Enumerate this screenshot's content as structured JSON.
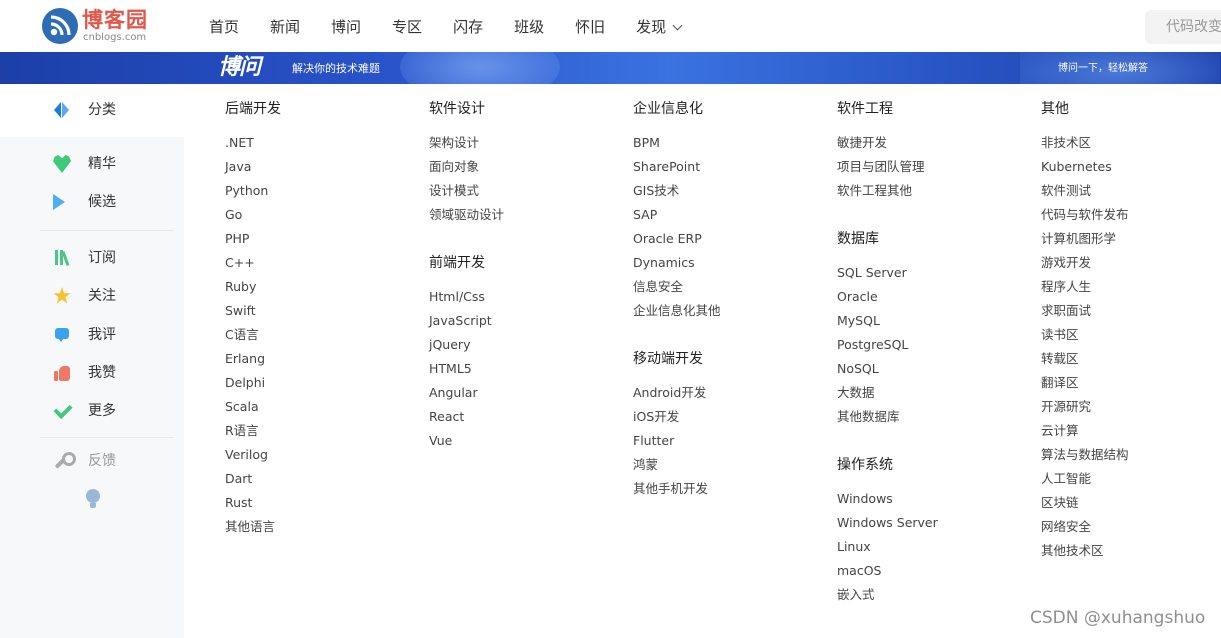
{
  "header": {
    "logo_name": "博客园",
    "logo_sub": "cnblogs.com",
    "nav": [
      "首页",
      "新闻",
      "博问",
      "专区",
      "闪存",
      "班级",
      "怀旧",
      "发现"
    ],
    "search_placeholder": "代码改变"
  },
  "banner": {
    "brand": "博问",
    "slogan": "解决你的技术难题",
    "right_text": "博问一下，轻松解答"
  },
  "sidebar": {
    "category": "分类",
    "items": [
      "精华",
      "候选",
      "订阅",
      "关注",
      "我评",
      "我赞",
      "更多"
    ],
    "feedback": "反馈"
  },
  "categories": {
    "backend": {
      "title": "后端开发",
      "items": [
        ".NET",
        "Java",
        "Python",
        "Go",
        "PHP",
        "C++",
        "Ruby",
        "Swift",
        "C语言",
        "Erlang",
        "Delphi",
        "Scala",
        "R语言",
        "Verilog",
        "Dart",
        "Rust",
        "其他语言"
      ]
    },
    "software_design": {
      "title": "软件设计",
      "items": [
        "架构设计",
        "面向对象",
        "设计模式",
        "领域驱动设计"
      ]
    },
    "frontend": {
      "title": "前端开发",
      "items": [
        "Html/Css",
        "JavaScript",
        "jQuery",
        "HTML5",
        "Angular",
        "React",
        "Vue"
      ]
    },
    "enterprise": {
      "title": "企业信息化",
      "items": [
        "BPM",
        "SharePoint",
        "GIS技术",
        "SAP",
        "Oracle ERP",
        "Dynamics",
        "信息安全",
        "企业信息化其他"
      ]
    },
    "mobile": {
      "title": "移动端开发",
      "items": [
        "Android开发",
        "iOS开发",
        "Flutter",
        "鸿蒙",
        "其他手机开发"
      ]
    },
    "software_engineering": {
      "title": "软件工程",
      "items": [
        "敏捷开发",
        "项目与团队管理",
        "软件工程其他"
      ]
    },
    "database": {
      "title": "数据库",
      "items": [
        "SQL Server",
        "Oracle",
        "MySQL",
        "PostgreSQL",
        "NoSQL",
        "大数据",
        "其他数据库"
      ]
    },
    "os": {
      "title": "操作系统",
      "items": [
        "Windows",
        "Windows Server",
        "Linux",
        "macOS",
        "嵌入式"
      ]
    },
    "other": {
      "title": "其他",
      "items": [
        "非技术区",
        "Kubernetes",
        "软件测试",
        "代码与软件发布",
        "计算机图形学",
        "游戏开发",
        "程序人生",
        "求职面试",
        "读书区",
        "转载区",
        "翻译区",
        "开源研究",
        "云计算",
        "算法与数据结构",
        "人工智能",
        "区块链",
        "网络安全",
        "其他技术区"
      ]
    }
  },
  "watermark": "CSDN @xuhangshuo",
  "colors": {
    "brand_red": "#e2574c",
    "banner_blue": "#2852c8",
    "sidebar_bg": "#f7f8fa"
  }
}
